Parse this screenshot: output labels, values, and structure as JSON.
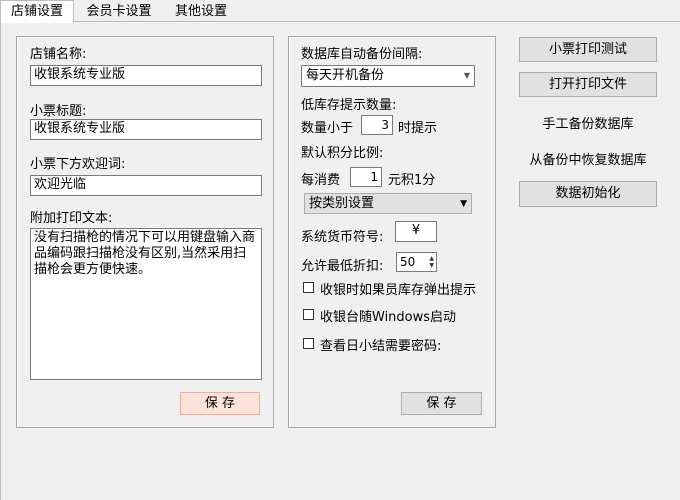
{
  "tabs": [
    "店铺设置",
    "会员卡设置",
    "其他设置"
  ],
  "shop": {
    "name_label": "店铺名称:",
    "name_value": "收银系统专业版",
    "receipt_title_label": "小票标题:",
    "receipt_title_value": "收银系统专业版",
    "welcome_label": "小票下方欢迎词:",
    "welcome_value": "欢迎光临",
    "extra_text_label": "附加打印文本:",
    "extra_text_value": "没有扫描枪的情况下可以用键盘输入商品编码跟扫描枪没有区别,当然采用扫描枪会更方便快速。",
    "save_label": "保 存"
  },
  "db": {
    "backup_interval_label": "数据库自动备份间隔:",
    "backup_interval_value": "每天开机备份",
    "low_stock_label": "低库存提示数量:",
    "qty_prefix": "数量小于",
    "qty_value": "3",
    "qty_suffix": "时提示",
    "points_ratio_label": "默认积分比例:",
    "points_prefix": "每消费",
    "points_value": "1",
    "points_suffix": "元积1分",
    "category_mode_value": "按类别设置",
    "currency_label": "系统货币符号:",
    "currency_value": "¥",
    "min_discount_label": "允许最低折扣:",
    "min_discount_value": "50",
    "opt_stock_popup": "收银时如果员库存弹出提示",
    "opt_autostart": "收银台随Windows启动",
    "opt_daily_pwd": "查看日小结需要密码:",
    "save_label": "保 存"
  },
  "actions": {
    "print_test": "小票打印测试",
    "open_print_file": "打开打印文件",
    "manual_backup": "手工备份数据库",
    "restore_backup": "从备份中恢复数据库",
    "init_data": "数据初始化"
  }
}
